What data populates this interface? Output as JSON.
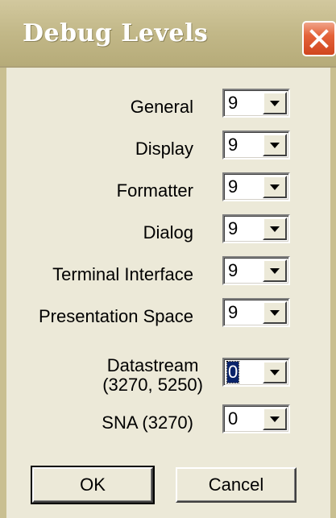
{
  "window": {
    "title": "Debug Levels"
  },
  "rows": [
    {
      "label": "General",
      "value": "9"
    },
    {
      "label": "Display",
      "value": "9"
    },
    {
      "label": "Formatter",
      "value": "9"
    },
    {
      "label": "Dialog",
      "value": "9"
    },
    {
      "label": "Terminal Interface",
      "value": "9"
    },
    {
      "label": "Presentation Space",
      "value": "9"
    },
    {
      "label_line1": "Datastream",
      "label_line2": "(3270, 5250)",
      "value": "0"
    },
    {
      "label": "SNA (3270)",
      "value": "0"
    }
  ],
  "buttons": {
    "ok": "OK",
    "cancel": "Cancel"
  },
  "icons": {
    "close": "close-icon",
    "dropdown": "chevron-down-icon"
  },
  "colors": {
    "titlebar": "#c2b888",
    "close": "#e4633a",
    "face": "#ece9d8"
  }
}
